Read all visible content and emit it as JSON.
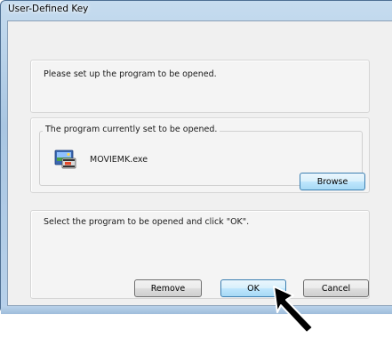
{
  "window": {
    "title": "User-Defined Key"
  },
  "instructions": {
    "setup_text": "Please set up the program to be opened."
  },
  "current_program": {
    "group_label": "The program currently set to be opened.",
    "program_name": "MOVIEMK.exe",
    "icon": "movie-maker-icon",
    "browse_label": "Browse"
  },
  "selection": {
    "hint_text": "Select the program to be opened and click \"OK\"."
  },
  "buttons": {
    "remove_label": "Remove",
    "ok_label": "OK",
    "cancel_label": "Cancel"
  },
  "cursor": {
    "icon": "arrow-pointer-icon"
  }
}
